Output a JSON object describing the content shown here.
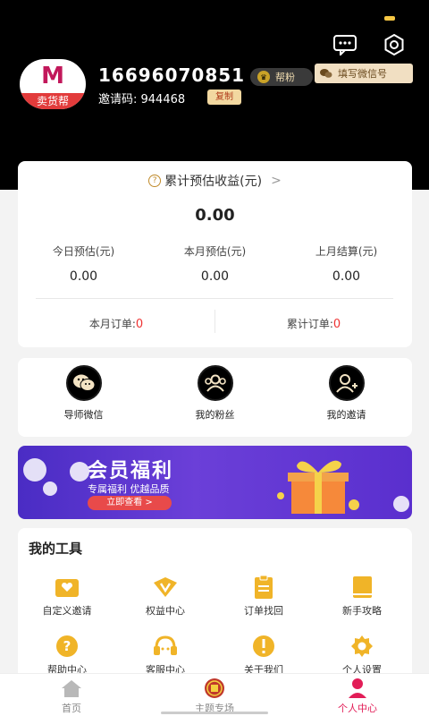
{
  "header": {
    "phone": "16696070851",
    "badge_label": "帮粉",
    "wechat_button": "填写微信号",
    "invite_label": "邀请码: 944468",
    "copy_button": "复制",
    "avatar_text": "卖货帮",
    "avatar_logo": "M"
  },
  "earnings": {
    "title": "累计预估收益(元)",
    "chevron": ">",
    "total": "0.00",
    "stats": [
      {
        "label": "今日预估(元)",
        "value": "0.00"
      },
      {
        "label": "本月预估(元)",
        "value": "0.00"
      },
      {
        "label": "上月结算(元)",
        "value": "0.00"
      }
    ],
    "month_orders_label": "本月订单:",
    "month_orders_value": "0",
    "total_orders_label": "累计订单:",
    "total_orders_value": "0"
  },
  "shortcuts": [
    {
      "label": "导师微信",
      "icon": "wechat-icon"
    },
    {
      "label": "我的粉丝",
      "icon": "fans-icon"
    },
    {
      "label": "我的邀请",
      "icon": "add-user-icon"
    }
  ],
  "banner": {
    "title": "会员福利",
    "subtitle": "专属福利 优越品质",
    "cta": "立即查看 >"
  },
  "tools": {
    "title": "我的工具",
    "items": [
      {
        "label": "自定义邀请",
        "icon": "invite-card-icon"
      },
      {
        "label": "权益中心",
        "icon": "vip-icon"
      },
      {
        "label": "订单找回",
        "icon": "clipboard-icon"
      },
      {
        "label": "新手攻略",
        "icon": "book-icon"
      },
      {
        "label": "帮助中心",
        "icon": "help-icon"
      },
      {
        "label": "客服中心",
        "icon": "headset-icon"
      },
      {
        "label": "关于我们",
        "icon": "info-icon"
      },
      {
        "label": "个人设置",
        "icon": "gear-icon"
      }
    ]
  },
  "tabbar": [
    {
      "label": "首页",
      "icon": "home-icon",
      "active": false
    },
    {
      "label": "主题专场",
      "icon": "theme-icon",
      "active": false
    },
    {
      "label": "个人中心",
      "icon": "person-icon",
      "active": true
    }
  ],
  "colors": {
    "accent": "#e21d57",
    "gold": "#f6c744",
    "header_bg": "#000000"
  }
}
